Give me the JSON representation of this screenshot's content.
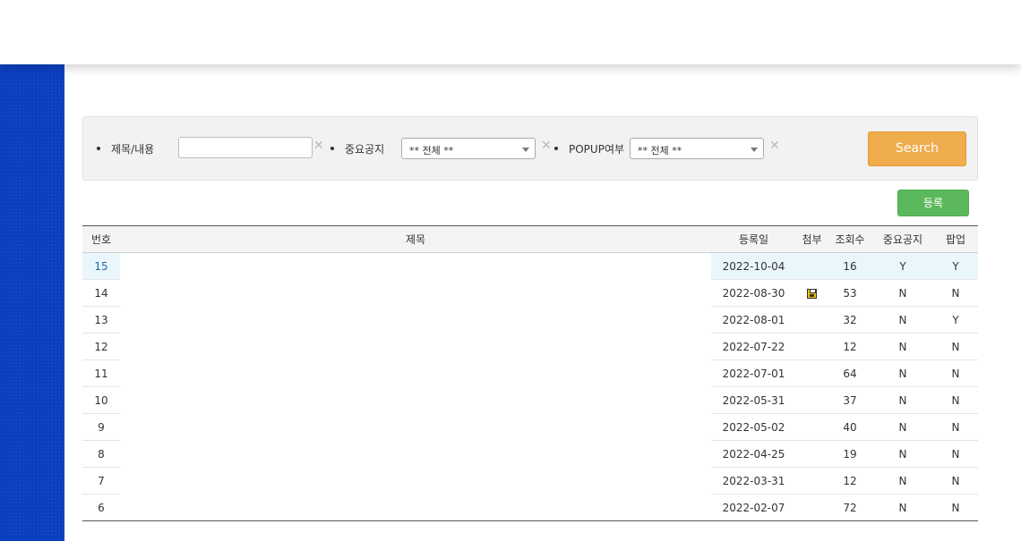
{
  "search": {
    "title_label": "제목/내용",
    "title_value": "",
    "notice_label": "중요공지",
    "notice_selected": "** 전체 **",
    "popup_label": "POPUP여부",
    "popup_selected": "** 전체 **",
    "clear_glyph": "✕",
    "search_button": "Search"
  },
  "register_button": "등록",
  "table": {
    "headers": [
      "번호",
      "제목",
      "등록일",
      "첨부",
      "조회수",
      "중요공지",
      "팝업"
    ],
    "rows": [
      {
        "num": "15",
        "title": "",
        "date": "2022-10-04",
        "attach": false,
        "views": "16",
        "notice": "Y",
        "popup": "Y"
      },
      {
        "num": "14",
        "title": "",
        "date": "2022-08-30",
        "attach": true,
        "views": "53",
        "notice": "N",
        "popup": "N"
      },
      {
        "num": "13",
        "title": "",
        "date": "2022-08-01",
        "attach": false,
        "views": "32",
        "notice": "N",
        "popup": "Y"
      },
      {
        "num": "12",
        "title": "",
        "date": "2022-07-22",
        "attach": false,
        "views": "12",
        "notice": "N",
        "popup": "N"
      },
      {
        "num": "11",
        "title": "",
        "date": "2022-07-01",
        "attach": false,
        "views": "64",
        "notice": "N",
        "popup": "N"
      },
      {
        "num": "10",
        "title": "",
        "date": "2022-05-31",
        "attach": false,
        "views": "37",
        "notice": "N",
        "popup": "N"
      },
      {
        "num": "9",
        "title": "",
        "date": "2022-05-02",
        "attach": false,
        "views": "40",
        "notice": "N",
        "popup": "N"
      },
      {
        "num": "8",
        "title": "",
        "date": "2022-04-25",
        "attach": false,
        "views": "19",
        "notice": "N",
        "popup": "N"
      },
      {
        "num": "7",
        "title": "",
        "date": "2022-03-31",
        "attach": false,
        "views": "12",
        "notice": "N",
        "popup": "N"
      },
      {
        "num": "6",
        "title": "",
        "date": "2022-02-07",
        "attach": false,
        "views": "72",
        "notice": "N",
        "popup": "N"
      }
    ]
  },
  "colors": {
    "sidebar": "#0a3ebf",
    "search_button": "#f0ad4e",
    "register_button": "#5cb85c",
    "highlight_row": "#e9f6fc"
  },
  "icons": {
    "attachment": "floppy-disk-icon"
  }
}
